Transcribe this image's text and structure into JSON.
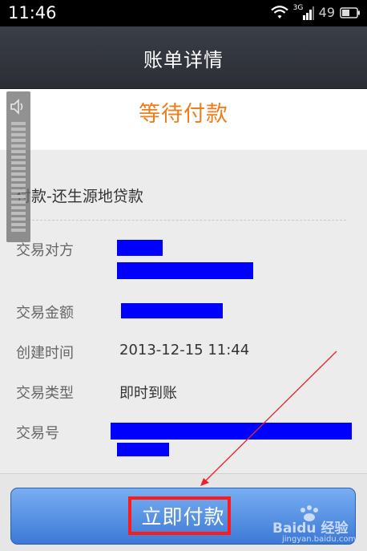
{
  "status_bar": {
    "time": "11:46",
    "network": "3G",
    "battery": "49"
  },
  "title_bar": {
    "title": "账单详情"
  },
  "status_banner": {
    "text": "等待付款",
    "color": "#f07d1c"
  },
  "details": {
    "subject": "付款-还生源地贷款",
    "rows": [
      {
        "label": "交易对方",
        "value": ""
      },
      {
        "label": "交易金额",
        "value": ""
      },
      {
        "label": "创建时间",
        "value": "2013-12-15 11:44"
      },
      {
        "label": "交易类型",
        "value": "即时到账"
      },
      {
        "label": "交易号",
        "value": ""
      }
    ]
  },
  "pay_button": {
    "label": "立即付款",
    "color": "#3c79d6"
  },
  "watermark": {
    "text": "Baidu 经验",
    "url": "jingyan.baidu.com"
  },
  "colors": {
    "redaction": "#0000ff",
    "highlight": "#ff1a1a"
  }
}
